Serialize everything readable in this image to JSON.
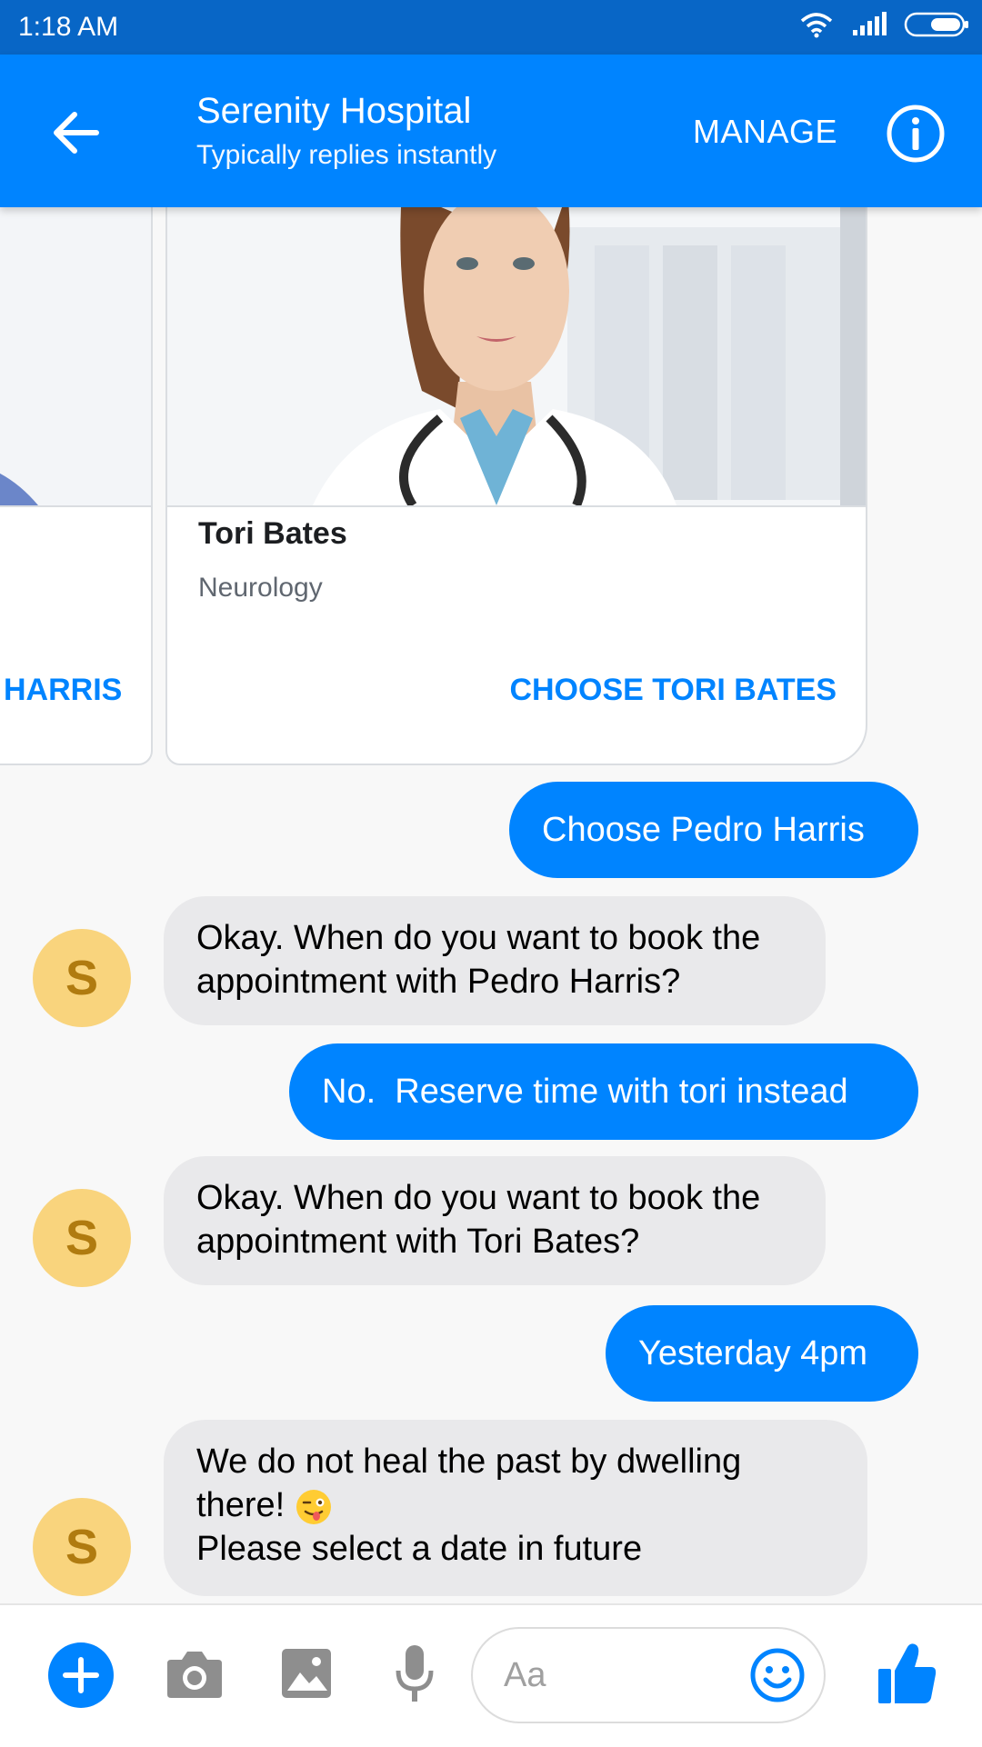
{
  "status_bar": {
    "time": "1:18 AM"
  },
  "header": {
    "title": "Serenity Hospital",
    "subtitle": "Typically replies instantly",
    "manage_label": "MANAGE"
  },
  "carousel": {
    "left_card_button": "HARRIS",
    "main_card": {
      "name": "Tori Bates",
      "department": "Neurology",
      "button": "CHOOSE TORI BATES"
    }
  },
  "messages": [
    {
      "from": "user",
      "text": "Choose Pedro Harris"
    },
    {
      "from": "bot",
      "avatar": "S",
      "line1": "Okay. When do you want to book the",
      "line2": "appointment with Pedro Harris?"
    },
    {
      "from": "user",
      "text": "No.  Reserve time with tori instead"
    },
    {
      "from": "bot",
      "avatar": "S",
      "line1": "Okay. When do you want to book the",
      "line2": "appointment with Tori Bates?"
    },
    {
      "from": "user",
      "text": "Yesterday 4pm"
    },
    {
      "from": "bot",
      "avatar": "S",
      "line1": "We do not heal the past by dwelling",
      "line2": "there!",
      "emoji": "winking-face-with-tongue",
      "line3": "Please select a date in future"
    }
  ],
  "composer": {
    "placeholder": "Aa"
  },
  "colors": {
    "status_bar": "#0866c6",
    "header": "#0084ff",
    "outgoing_bubble": "#0084ff",
    "incoming_bubble": "#e9e9eb",
    "avatar_bg": "#f9d47d"
  }
}
